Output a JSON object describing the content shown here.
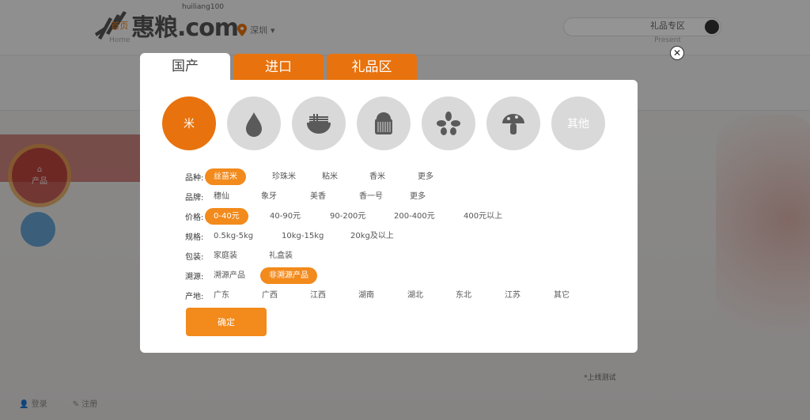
{
  "header": {
    "logo_text": "惠粮.com",
    "logo_sup": "huiliang100",
    "location": "深圳",
    "search_placeholder": ""
  },
  "nav": {
    "home": {
      "label": "首页",
      "sub": "Home"
    },
    "present": {
      "label": "礼品专区",
      "sub": "Present"
    }
  },
  "side": {
    "product_label": "产品"
  },
  "bottom": {
    "login": "登录",
    "register": "注册",
    "note": "*上线测试"
  },
  "modal": {
    "tabs": [
      "国产",
      "进口",
      "礼品区"
    ],
    "close_icon": "close-icon",
    "categories": [
      {
        "label": "米",
        "icon": "text",
        "active": true
      },
      {
        "label": "",
        "icon": "oil-drop-icon"
      },
      {
        "label": "",
        "icon": "noodle-bowl-icon"
      },
      {
        "label": "",
        "icon": "flour-jar-icon"
      },
      {
        "label": "",
        "icon": "seeds-icon"
      },
      {
        "label": "",
        "icon": "mushroom-icon"
      },
      {
        "label": "其他",
        "icon": "text"
      }
    ],
    "filters": [
      {
        "label": "品种:",
        "options": [
          "丝苗米",
          "珍珠米",
          "粘米",
          "香米",
          "更多"
        ],
        "selected": 0,
        "x": [
          0,
          74,
          137,
          197,
          258
        ]
      },
      {
        "label": "品牌:",
        "options": [
          "穗仙",
          "象牙",
          "美香",
          "香一号",
          "更多"
        ],
        "selected": -1,
        "x": [
          0,
          60,
          122,
          184,
          248
        ]
      },
      {
        "label": "价格:",
        "options": [
          "0-40元",
          "40-90元",
          "90-200元",
          "200-400元",
          "400元以上"
        ],
        "selected": 0,
        "x": [
          0,
          71,
          147,
          228,
          316
        ]
      },
      {
        "label": "规格:",
        "options": [
          "0.5kg-5kg",
          "10kg-15kg",
          "20kg及以上"
        ],
        "selected": -1,
        "x": [
          0,
          86,
          173
        ]
      },
      {
        "label": "包装:",
        "options": [
          "家庭装",
          "礼盒装"
        ],
        "selected": -1,
        "x": [
          0,
          70
        ]
      },
      {
        "label": "溯源:",
        "options": [
          "溯源产品",
          "非溯源产品"
        ],
        "selected": 1,
        "x": [
          0,
          70
        ]
      },
      {
        "label": "产地:",
        "options": [
          "广东",
          "广西",
          "江西",
          "湖南",
          "湖北",
          "东北",
          "江苏",
          "其它"
        ],
        "selected": -1,
        "x": [
          0,
          61,
          122,
          183,
          245,
          306,
          368,
          430
        ]
      }
    ],
    "confirm_label": "确定"
  },
  "colors": {
    "accent": "#e8720d",
    "selected_pill": "#f28a1c",
    "inactive_circle": "#d9d9d9"
  }
}
